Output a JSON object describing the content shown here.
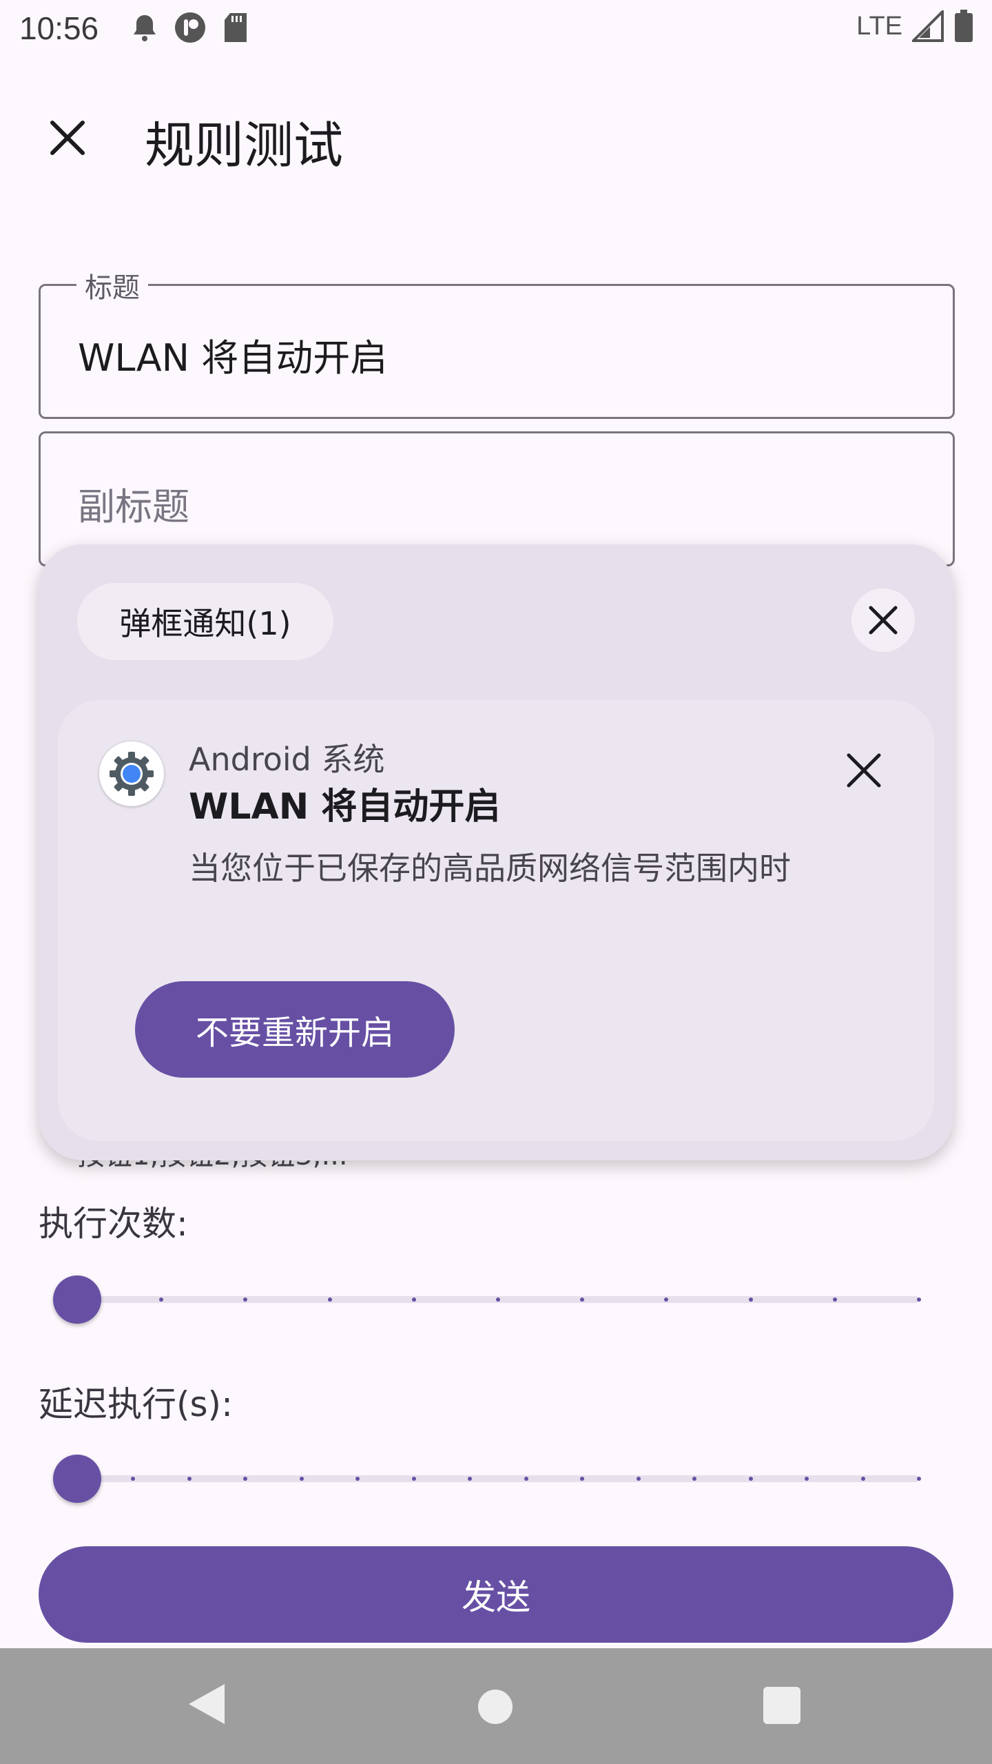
{
  "status_bar": {
    "time": "10:56",
    "network": "LTE",
    "icons": [
      "notification-bell-icon",
      "app-icon",
      "sd-card-icon",
      "signal-icon",
      "battery-icon"
    ]
  },
  "app_bar": {
    "title": "规则测试",
    "close_icon": "close-icon"
  },
  "form": {
    "title_field": {
      "label": "标题",
      "value": "WLAN 将自动开启"
    },
    "subtitle_field": {
      "placeholder": "副标题"
    },
    "partial_helper_text": "按钮1,按钮2,按钮3,..."
  },
  "sliders": [
    {
      "label": "执行次数:",
      "value": 0,
      "steps": 10
    },
    {
      "label": "延迟执行(s):",
      "value": 0,
      "steps": 15
    }
  ],
  "send_button": "发送",
  "popup": {
    "chip_label": "弹框通知(1)",
    "notification": {
      "app_name": "Android 系统",
      "title": "WLAN 将自动开启",
      "body": "当您位于已保存的高品质网络信号范围内时",
      "action": "不要重新开启"
    }
  },
  "colors": {
    "accent": "#6750a4",
    "background": "#fdf8fd",
    "popup_bg": "#e6e0ec",
    "nav_bar": "#9e9e9e"
  }
}
